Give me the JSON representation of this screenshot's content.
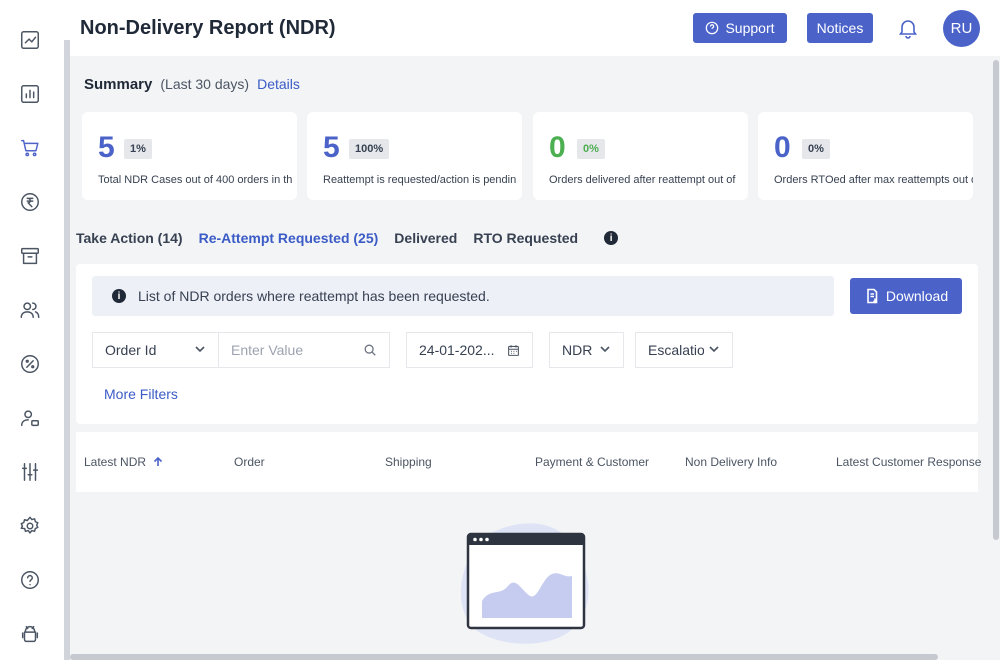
{
  "header": {
    "title": "Non-Delivery Report (NDR)",
    "support_label": "Support",
    "notices_label": "Notices",
    "avatar_initials": "RU"
  },
  "sidebar": {
    "items": [
      {
        "icon": "trend-chart-icon"
      },
      {
        "icon": "bar-chart-icon"
      },
      {
        "icon": "cart-icon",
        "active": true
      },
      {
        "icon": "rupee-icon"
      },
      {
        "icon": "archive-box-icon"
      },
      {
        "icon": "users-icon"
      },
      {
        "icon": "percent-icon"
      },
      {
        "icon": "user-settings-icon"
      },
      {
        "icon": "sliders-icon"
      },
      {
        "icon": "gear-icon"
      },
      {
        "icon": "help-icon"
      },
      {
        "icon": "android-icon"
      }
    ]
  },
  "summary": {
    "title": "Summary",
    "period": "(Last 30 days)",
    "details_link": "Details",
    "cards": [
      {
        "value": "5",
        "badge": "1%",
        "text": "Total NDR Cases out of 400 orders in th",
        "color": "#4b63c9"
      },
      {
        "value": "5",
        "badge": "100%",
        "text": "Reattempt is requested/action is pendin",
        "color": "#4b63c9"
      },
      {
        "value": "0",
        "badge": "0%",
        "text": "Orders delivered after reattempt out of",
        "color": "#4caf50"
      },
      {
        "value": "0",
        "badge": "0%",
        "text": "Orders RTOed after max reattempts out o",
        "color": "#4b63c9"
      }
    ]
  },
  "tabs": [
    {
      "label": "Take Action (14)",
      "active": false
    },
    {
      "label": "Re-Attempt Requested (25)",
      "active": true
    },
    {
      "label": "Delivered",
      "active": false
    },
    {
      "label": "RTO Requested",
      "active": false
    }
  ],
  "panel": {
    "notice_text": "List of NDR orders where reattempt has been requested.",
    "download_label": "Download",
    "filters": {
      "order_select": "Order Id",
      "value_placeholder": "Enter Value",
      "date_value": "24-01-202...",
      "ndr_select": "NDR",
      "escalation_select": "Escalatio"
    },
    "more_filters": "More Filters"
  },
  "table": {
    "columns": [
      "Latest NDR",
      "Order",
      "Shipping",
      "Payment & Customer",
      "Non Delivery Info",
      "Latest Customer Response"
    ]
  },
  "colors": {
    "accent": "#4b63c9",
    "success": "#4caf50"
  }
}
